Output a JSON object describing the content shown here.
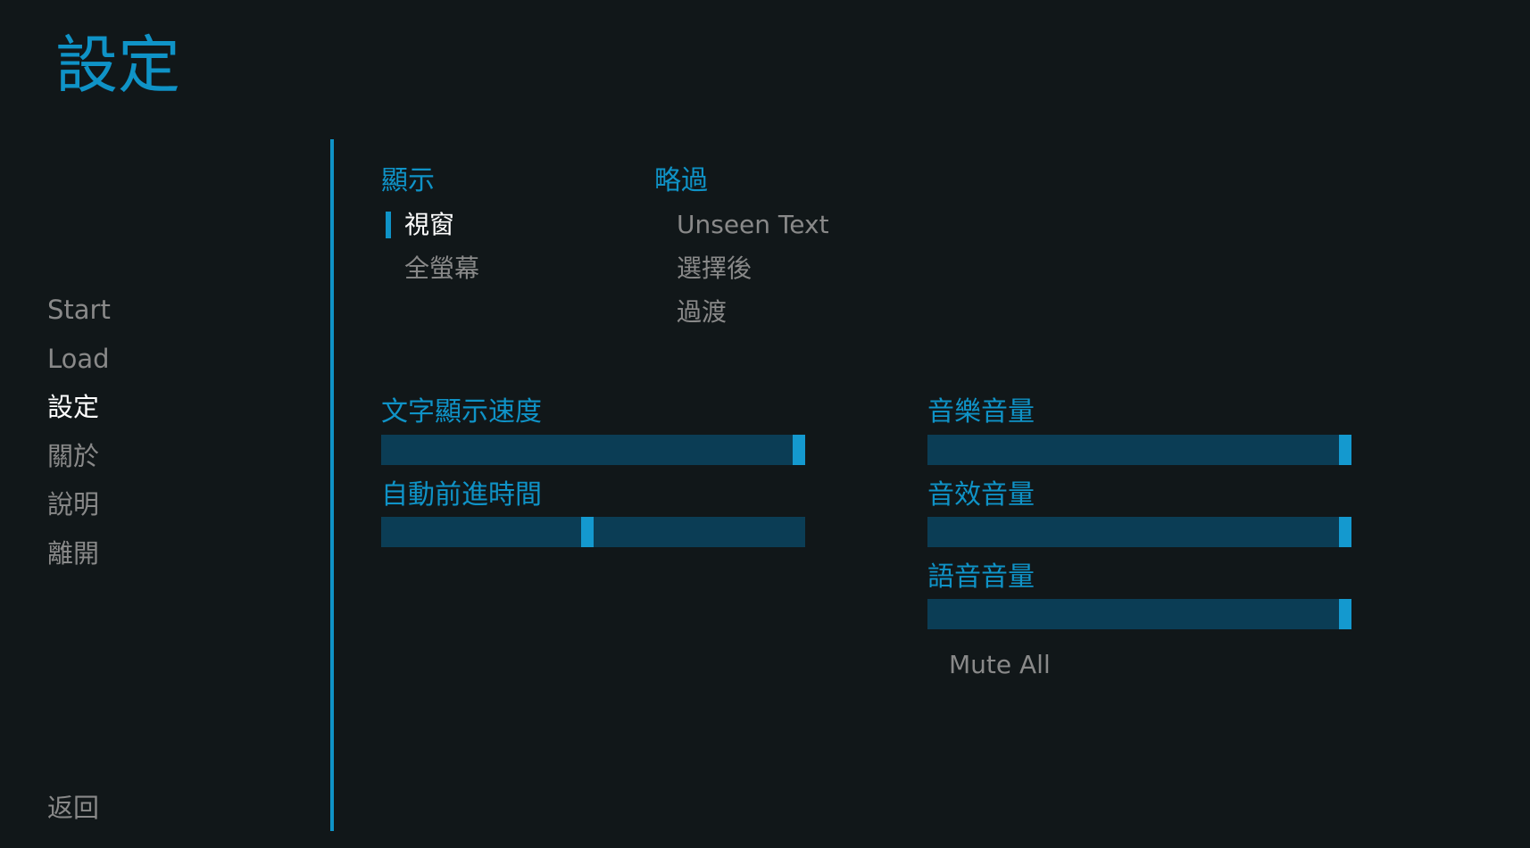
{
  "page": {
    "title": "設定"
  },
  "nav": {
    "items": [
      {
        "label": "Start",
        "active": false
      },
      {
        "label": "Load",
        "active": false
      },
      {
        "label": "設定",
        "active": true
      },
      {
        "label": "關於",
        "active": false
      },
      {
        "label": "說明",
        "active": false
      },
      {
        "label": "離開",
        "active": false
      }
    ],
    "back_label": "返回"
  },
  "display": {
    "label": "顯示",
    "options": [
      {
        "label": "視窗",
        "selected": true
      },
      {
        "label": "全螢幕",
        "selected": false
      }
    ]
  },
  "skip": {
    "label": "略過",
    "options": [
      {
        "label": "Unseen Text",
        "selected": false
      },
      {
        "label": "選擇後",
        "selected": false
      },
      {
        "label": "過渡",
        "selected": false
      }
    ]
  },
  "sliders": {
    "text_speed": {
      "label": "文字顯示速度",
      "value": 1.0
    },
    "auto_forward": {
      "label": "自動前進時間",
      "value": 0.5
    },
    "music_volume": {
      "label": "音樂音量",
      "value": 1.0
    },
    "sound_volume": {
      "label": "音效音量",
      "value": 1.0
    },
    "voice_volume": {
      "label": "語音音量",
      "value": 1.0
    }
  },
  "mute_all": {
    "label": "Mute All"
  },
  "colors": {
    "accent": "#0f93c7",
    "background": "#111719",
    "bar_track": "#0b3d55",
    "idle_text": "#898989",
    "active_text": "#ffffff"
  }
}
